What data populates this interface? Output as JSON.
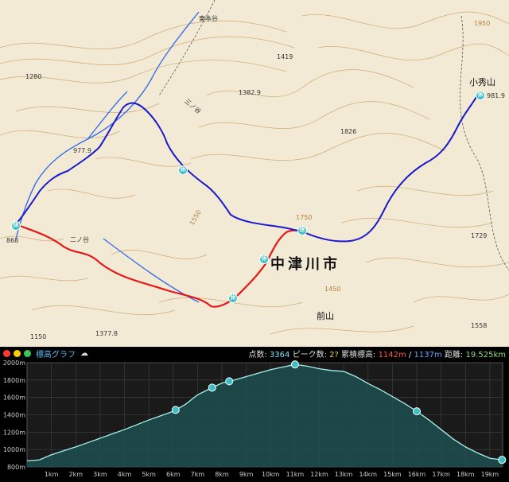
{
  "map": {
    "city_label": "中津川市",
    "peak_names": [
      {
        "key": "kohide",
        "label": "小秀山"
      },
      {
        "key": "maeyama",
        "label": "前山"
      }
    ],
    "valley_names": [
      {
        "key": "higashimotodani",
        "label": "東本谷"
      },
      {
        "key": "sannotani",
        "label": "三ノ谷"
      },
      {
        "key": "ninotani",
        "label": "二ノ谷"
      }
    ],
    "spot_heights": [
      "1280",
      "1419",
      "1382.9",
      "1826",
      "977.9",
      "981.9",
      "1729",
      "868",
      "1150",
      "1377.8",
      "1558",
      "1950",
      "1550",
      "1750",
      "1450"
    ],
    "rest_marker_label": "休",
    "colors": {
      "descent_route": "#1a1acc",
      "ascent_route": "#e81818",
      "river": "#3a6ee8",
      "contour": "#c9a066",
      "rest_marker": "#3bbfc7"
    }
  },
  "profile": {
    "header_title": "標高グラフ",
    "window_buttons": [
      "red",
      "yellow",
      "green"
    ],
    "stats": {
      "points_label": "点数:",
      "points_value": "3364",
      "peaks_label": "ピーク数:",
      "peaks_value": "2?",
      "cum_label": "累積標高:",
      "cum_up": "1142m",
      "separator": "/",
      "cum_down": "1137m",
      "distance_label": "距離:",
      "distance_value": "19.525km"
    },
    "chart_data": {
      "type": "area",
      "x_unit": "km",
      "y_unit": "m",
      "xlim": [
        0,
        19.525
      ],
      "ylim": [
        800,
        2000
      ],
      "y_ticks": [
        "800m",
        "1000m",
        "1200m",
        "1400m",
        "1600m",
        "1800m",
        "2000m"
      ],
      "x_ticks": [
        "1km",
        "2km",
        "3km",
        "4km",
        "5km",
        "6km",
        "7km",
        "8km",
        "9km",
        "10km",
        "11km",
        "12km",
        "13km",
        "14km",
        "15km",
        "16km",
        "17km",
        "18km",
        "19km"
      ],
      "grid": true,
      "x": [
        0,
        0.5,
        1,
        1.5,
        2,
        2.5,
        3,
        3.5,
        4,
        4.5,
        5,
        5.5,
        6,
        6.5,
        7,
        7.5,
        8,
        8.5,
        9,
        9.5,
        10,
        10.5,
        11,
        11.5,
        12,
        12.5,
        13,
        13.5,
        14,
        14.5,
        15,
        15.5,
        16,
        16.5,
        17,
        17.5,
        18,
        18.5,
        19,
        19.525
      ],
      "values": [
        870,
        880,
        940,
        985,
        1030,
        1080,
        1130,
        1180,
        1230,
        1285,
        1340,
        1390,
        1440,
        1520,
        1630,
        1700,
        1765,
        1800,
        1840,
        1880,
        1920,
        1950,
        1980,
        1960,
        1930,
        1910,
        1900,
        1840,
        1760,
        1690,
        1610,
        1530,
        1440,
        1340,
        1230,
        1120,
        1030,
        960,
        900,
        880
      ],
      "rest_points_km": [
        6.1,
        7.6,
        8.3,
        11.0,
        16.0,
        19.5
      ]
    }
  }
}
